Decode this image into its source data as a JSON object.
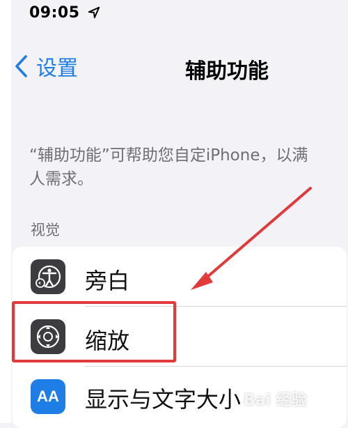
{
  "status_bar": {
    "time": "09:05",
    "location_icon": "location-arrow-icon"
  },
  "nav": {
    "back_label": "设置",
    "title": "辅助功能"
  },
  "description": {
    "line1": "“辅助功能”可帮助您自定iPhone，以满",
    "line2": "人需求。"
  },
  "section_header": "视觉",
  "rows": [
    {
      "label": "旁白",
      "icon": "voiceover-icon"
    },
    {
      "label": "缩放",
      "icon": "zoom-icon"
    },
    {
      "label": "显示与文字大小",
      "icon": "display-text-size-icon",
      "icon_text": "AA"
    }
  ],
  "colors": {
    "accent": "#1f7de6",
    "highlight": "#e23a3a",
    "background": "#f2f2f7",
    "icon_dark": "#3b3b40"
  },
  "watermark": "Bai 经验"
}
